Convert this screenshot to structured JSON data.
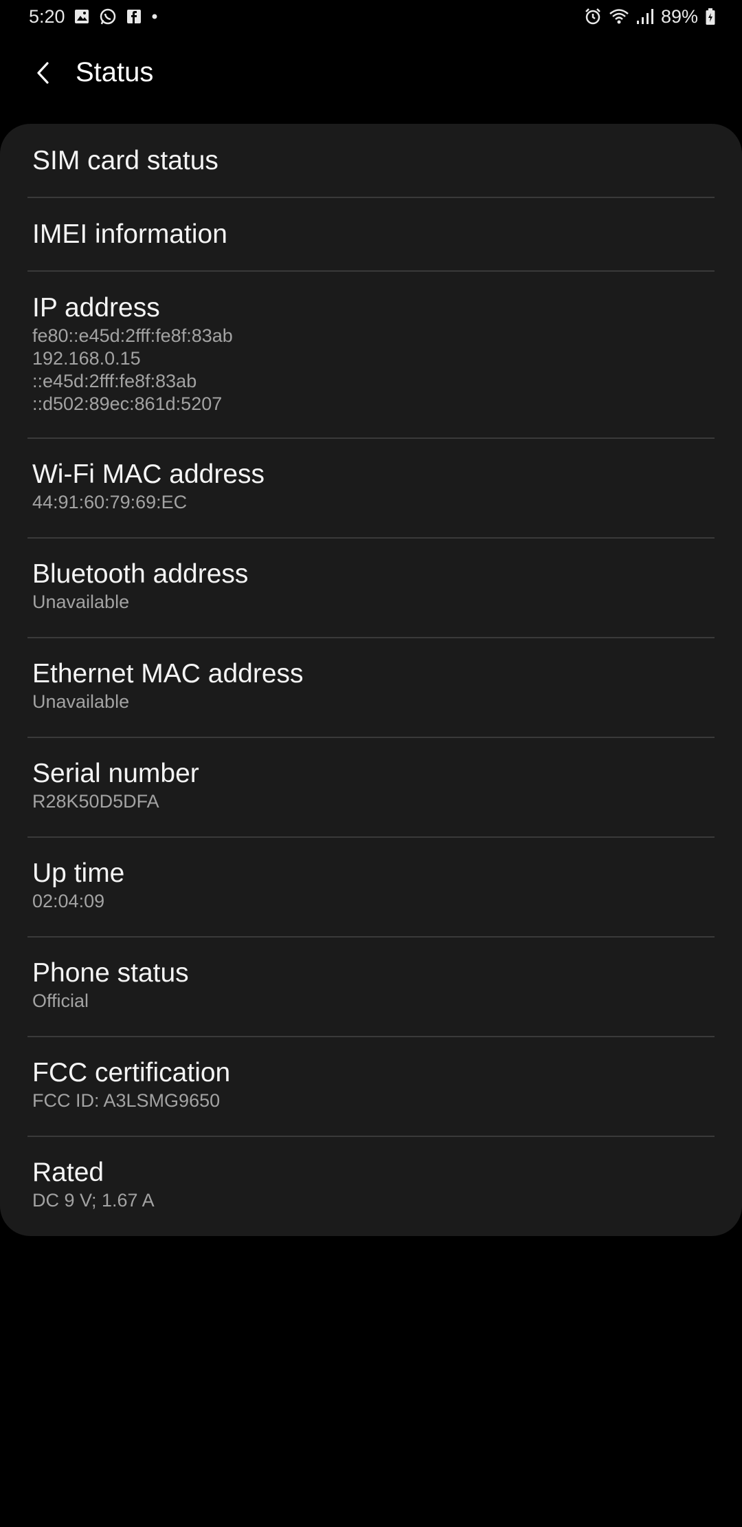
{
  "status_bar": {
    "time": "5:20",
    "left_icons": [
      "gallery-icon",
      "whatsapp-icon",
      "facebook-icon",
      "dot-icon"
    ],
    "right_icons": [
      "alarm-icon",
      "wifi-icon",
      "signal-icon",
      "battery-icon"
    ],
    "battery_text": "89%"
  },
  "header": {
    "title": "Status",
    "back_icon": "chevron-left-icon"
  },
  "colors": {
    "background": "#000000",
    "card": "#1b1b1b",
    "divider": "#3a3a3a",
    "title_text": "#f4f4f4",
    "subtitle_text": "#a3a3a3"
  },
  "items": [
    {
      "title": "SIM card status",
      "lines": []
    },
    {
      "title": "IMEI information",
      "lines": []
    },
    {
      "title": "IP address",
      "lines": [
        "fe80::e45d:2fff:fe8f:83ab",
        "192.168.0.15",
        "::e45d:2fff:fe8f:83ab",
        "::d502:89ec:861d:5207"
      ]
    },
    {
      "title": "Wi-Fi MAC address",
      "lines": [
        "44:91:60:79:69:EC"
      ]
    },
    {
      "title": "Bluetooth address",
      "lines": [
        "Unavailable"
      ]
    },
    {
      "title": "Ethernet MAC address",
      "lines": [
        "Unavailable"
      ]
    },
    {
      "title": "Serial number",
      "lines": [
        "R28K50D5DFA"
      ]
    },
    {
      "title": "Up time",
      "lines": [
        "02:04:09"
      ]
    },
    {
      "title": "Phone status",
      "lines": [
        "Official"
      ]
    },
    {
      "title": "FCC certification",
      "lines": [
        "FCC ID: A3LSMG9650"
      ]
    },
    {
      "title": "Rated",
      "lines": [
        "DC 9 V; 1.67 A"
      ]
    }
  ]
}
